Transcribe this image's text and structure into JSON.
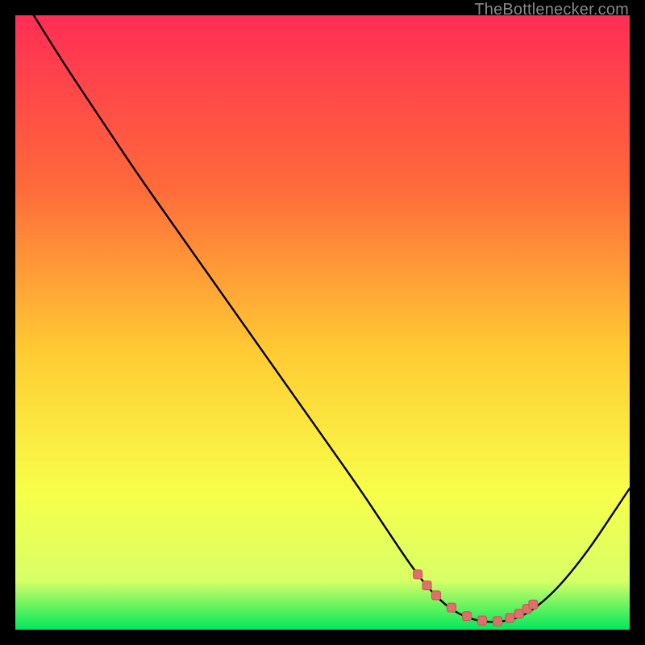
{
  "watermark": "TheBottlenecker.com",
  "colors": {
    "frame": "#000000",
    "grad_top": "#ff2d55",
    "grad_upper_mid": "#ff6a3a",
    "grad_mid": "#ffcc33",
    "grad_lower_mid": "#f7ff4a",
    "grad_low": "#d8ff66",
    "grad_bottom": "#00e85b",
    "curve": "#000000",
    "marker_fill": "#df6f6d",
    "marker_stroke": "#c65653"
  },
  "chart_data": {
    "type": "line",
    "title": "",
    "xlabel": "",
    "ylabel": "",
    "xlim": [
      0,
      100
    ],
    "ylim": [
      0,
      100
    ],
    "x": [
      3,
      8,
      14,
      20,
      26,
      32,
      38,
      44,
      50,
      56,
      60,
      64,
      67,
      70,
      72.5,
      75,
      77.5,
      80,
      82.5,
      85,
      88,
      91,
      94,
      97,
      100
    ],
    "values": [
      100,
      92,
      83,
      74,
      65.5,
      57,
      48.5,
      40,
      31.5,
      23,
      17,
      11,
      7,
      4,
      2.4,
      1.5,
      1.2,
      1.4,
      2.2,
      3.8,
      6.5,
      10,
      14,
      18.5,
      23
    ],
    "marker_points_x": [
      65.5,
      67,
      68.5,
      71,
      73.5,
      76,
      78.5,
      80.5,
      82,
      83.3,
      84.3
    ],
    "marker_points_y": [
      9,
      7.2,
      5.6,
      3.6,
      2.2,
      1.5,
      1.4,
      1.9,
      2.6,
      3.4,
      4.1
    ]
  }
}
